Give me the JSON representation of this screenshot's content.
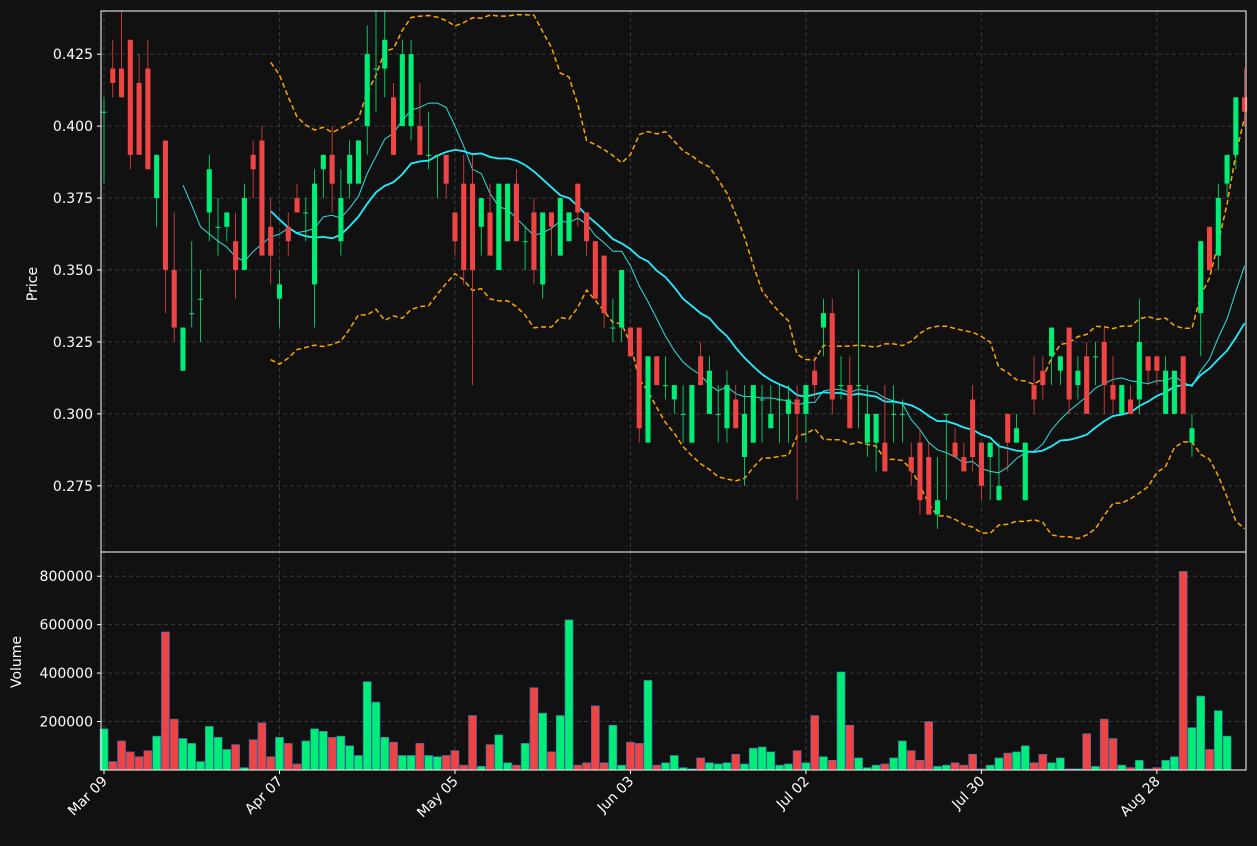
{
  "chart_data": {
    "type": "candlestick",
    "xticks": [
      "Mar 09",
      "Apr 07",
      "May 05",
      "Jun 03",
      "Jul 02",
      "Jul 30",
      "Aug 28"
    ],
    "xtick_index": [
      0,
      20,
      40,
      60,
      80,
      100,
      120
    ],
    "price_panel": {
      "ylabel": "Price",
      "ylim": [
        0.252,
        0.44
      ],
      "yticks": [
        "0.425",
        "0.400",
        "0.375",
        "0.350",
        "0.325",
        "0.300",
        "0.275"
      ],
      "ytick_values": [
        0.425,
        0.4,
        0.375,
        0.35,
        0.325,
        0.3,
        0.275
      ],
      "grid": true
    },
    "volume_panel": {
      "ylabel": "Volume",
      "ylim": [
        0,
        900000
      ],
      "yticks": [
        "200000",
        "400000",
        "600000",
        "800000"
      ],
      "ytick_values": [
        200000,
        400000,
        600000,
        800000
      ],
      "grid": true
    },
    "colors": {
      "background": "#111111",
      "up": "#00ee77",
      "down": "#ee4444",
      "ma_short": "#33dddd",
      "ma_long": "#22eeff",
      "bands": "#ffa500",
      "grid": "#3a3a3a",
      "axis": "#ffffff"
    },
    "ohlc": [
      [
        0.405,
        0.41,
        0.38,
        0.405
      ],
      [
        0.42,
        0.43,
        0.41,
        0.415
      ],
      [
        0.42,
        0.44,
        0.41,
        0.41
      ],
      [
        0.43,
        0.43,
        0.385,
        0.39
      ],
      [
        0.415,
        0.425,
        0.39,
        0.39
      ],
      [
        0.42,
        0.43,
        0.385,
        0.385
      ],
      [
        0.375,
        0.39,
        0.365,
        0.39
      ],
      [
        0.395,
        0.395,
        0.335,
        0.35
      ],
      [
        0.35,
        0.37,
        0.325,
        0.33
      ],
      [
        0.315,
        0.33,
        0.315,
        0.33
      ],
      [
        0.335,
        0.36,
        0.33,
        0.335
      ],
      [
        0.34,
        0.35,
        0.325,
        0.34
      ],
      [
        0.37,
        0.39,
        0.36,
        0.385
      ],
      [
        0.365,
        0.375,
        0.355,
        0.365
      ],
      [
        0.365,
        0.37,
        0.36,
        0.37
      ],
      [
        0.36,
        0.37,
        0.34,
        0.35
      ],
      [
        0.35,
        0.38,
        0.35,
        0.375
      ],
      [
        0.39,
        0.395,
        0.375,
        0.385
      ],
      [
        0.395,
        0.4,
        0.355,
        0.355
      ],
      [
        0.365,
        0.375,
        0.345,
        0.355
      ],
      [
        0.34,
        0.35,
        0.33,
        0.345
      ],
      [
        0.365,
        0.37,
        0.355,
        0.36
      ],
      [
        0.375,
        0.38,
        0.37,
        0.37
      ],
      [
        0.37,
        0.375,
        0.36,
        0.37
      ],
      [
        0.345,
        0.385,
        0.33,
        0.38
      ],
      [
        0.385,
        0.39,
        0.375,
        0.39
      ],
      [
        0.39,
        0.4,
        0.37,
        0.38
      ],
      [
        0.36,
        0.385,
        0.355,
        0.375
      ],
      [
        0.38,
        0.395,
        0.375,
        0.39
      ],
      [
        0.38,
        0.395,
        0.38,
        0.395
      ],
      [
        0.4,
        0.435,
        0.39,
        0.425
      ],
      [
        0.42,
        0.44,
        0.405,
        0.42
      ],
      [
        0.42,
        0.44,
        0.41,
        0.43
      ],
      [
        0.41,
        0.415,
        0.39,
        0.39
      ],
      [
        0.4,
        0.43,
        0.4,
        0.425
      ],
      [
        0.4,
        0.43,
        0.395,
        0.425
      ],
      [
        0.4,
        0.415,
        0.39,
        0.39
      ],
      [
        0.39,
        0.405,
        0.385,
        0.39
      ],
      [
        0.39,
        0.39,
        0.375,
        0.39
      ],
      [
        0.39,
        0.39,
        0.375,
        0.38
      ],
      [
        0.37,
        0.37,
        0.355,
        0.36
      ],
      [
        0.38,
        0.39,
        0.345,
        0.35
      ],
      [
        0.38,
        0.39,
        0.31,
        0.35
      ],
      [
        0.365,
        0.375,
        0.355,
        0.375
      ],
      [
        0.37,
        0.38,
        0.355,
        0.355
      ],
      [
        0.35,
        0.38,
        0.35,
        0.38
      ],
      [
        0.36,
        0.38,
        0.36,
        0.38
      ],
      [
        0.38,
        0.385,
        0.36,
        0.36
      ],
      [
        0.36,
        0.365,
        0.35,
        0.36
      ],
      [
        0.37,
        0.375,
        0.345,
        0.35
      ],
      [
        0.345,
        0.37,
        0.34,
        0.37
      ],
      [
        0.37,
        0.37,
        0.355,
        0.365
      ],
      [
        0.355,
        0.375,
        0.355,
        0.375
      ],
      [
        0.36,
        0.37,
        0.36,
        0.37
      ],
      [
        0.38,
        0.38,
        0.365,
        0.37
      ],
      [
        0.37,
        0.37,
        0.355,
        0.36
      ],
      [
        0.36,
        0.36,
        0.34,
        0.34
      ],
      [
        0.355,
        0.355,
        0.33,
        0.335
      ],
      [
        0.33,
        0.34,
        0.325,
        0.33
      ],
      [
        0.33,
        0.35,
        0.325,
        0.35
      ],
      [
        0.33,
        0.33,
        0.32,
        0.32
      ],
      [
        0.33,
        0.33,
        0.29,
        0.295
      ],
      [
        0.29,
        0.32,
        0.29,
        0.32
      ],
      [
        0.32,
        0.32,
        0.31,
        0.31
      ],
      [
        0.31,
        0.32,
        0.305,
        0.31
      ],
      [
        0.305,
        0.31,
        0.3,
        0.31
      ],
      [
        0.3,
        0.31,
        0.29,
        0.3
      ],
      [
        0.29,
        0.31,
        0.29,
        0.31
      ],
      [
        0.32,
        0.325,
        0.31,
        0.31
      ],
      [
        0.3,
        0.32,
        0.3,
        0.315
      ],
      [
        0.3,
        0.31,
        0.29,
        0.3
      ],
      [
        0.295,
        0.315,
        0.29,
        0.31
      ],
      [
        0.305,
        0.31,
        0.295,
        0.295
      ],
      [
        0.285,
        0.31,
        0.275,
        0.3
      ],
      [
        0.29,
        0.31,
        0.29,
        0.31
      ],
      [
        0.305,
        0.31,
        0.29,
        0.305
      ],
      [
        0.295,
        0.31,
        0.295,
        0.3
      ],
      [
        0.305,
        0.31,
        0.29,
        0.305
      ],
      [
        0.3,
        0.31,
        0.29,
        0.305
      ],
      [
        0.305,
        0.31,
        0.27,
        0.3
      ],
      [
        0.3,
        0.31,
        0.29,
        0.31
      ],
      [
        0.315,
        0.32,
        0.305,
        0.31
      ],
      [
        0.33,
        0.34,
        0.32,
        0.335
      ],
      [
        0.335,
        0.34,
        0.3,
        0.305
      ],
      [
        0.31,
        0.32,
        0.305,
        0.31
      ],
      [
        0.31,
        0.32,
        0.3,
        0.295
      ],
      [
        0.31,
        0.35,
        0.295,
        0.31
      ],
      [
        0.29,
        0.31,
        0.285,
        0.3
      ],
      [
        0.29,
        0.3,
        0.28,
        0.3
      ],
      [
        0.29,
        0.31,
        0.28,
        0.28
      ],
      [
        0.3,
        0.31,
        0.29,
        0.3
      ],
      [
        0.3,
        0.305,
        0.29,
        0.3
      ],
      [
        0.285,
        0.29,
        0.275,
        0.28
      ],
      [
        0.29,
        0.295,
        0.265,
        0.27
      ],
      [
        0.285,
        0.29,
        0.265,
        0.265
      ],
      [
        0.265,
        0.285,
        0.26,
        0.27
      ],
      [
        0.3,
        0.3,
        0.27,
        0.3
      ],
      [
        0.29,
        0.295,
        0.285,
        0.285
      ],
      [
        0.285,
        0.29,
        0.28,
        0.28
      ],
      [
        0.305,
        0.31,
        0.28,
        0.285
      ],
      [
        0.29,
        0.29,
        0.27,
        0.275
      ],
      [
        0.285,
        0.29,
        0.27,
        0.29
      ],
      [
        0.27,
        0.29,
        0.27,
        0.275
      ],
      [
        0.3,
        0.3,
        0.28,
        0.29
      ],
      [
        0.29,
        0.3,
        0.29,
        0.295
      ],
      [
        0.27,
        0.29,
        0.27,
        0.29
      ],
      [
        0.31,
        0.32,
        0.3,
        0.305
      ],
      [
        0.315,
        0.32,
        0.305,
        0.31
      ],
      [
        0.32,
        0.33,
        0.31,
        0.33
      ],
      [
        0.315,
        0.32,
        0.31,
        0.32
      ],
      [
        0.33,
        0.33,
        0.3,
        0.305
      ],
      [
        0.31,
        0.32,
        0.305,
        0.315
      ],
      [
        0.32,
        0.325,
        0.3,
        0.3
      ],
      [
        0.32,
        0.325,
        0.31,
        0.32
      ],
      [
        0.325,
        0.33,
        0.3,
        0.31
      ],
      [
        0.31,
        0.32,
        0.3,
        0.305
      ],
      [
        0.3,
        0.31,
        0.3,
        0.31
      ],
      [
        0.305,
        0.31,
        0.3,
        0.3
      ],
      [
        0.305,
        0.34,
        0.3,
        0.325
      ],
      [
        0.32,
        0.32,
        0.31,
        0.315
      ],
      [
        0.32,
        0.32,
        0.31,
        0.315
      ],
      [
        0.3,
        0.32,
        0.3,
        0.315
      ],
      [
        0.3,
        0.31,
        0.3,
        0.315
      ],
      [
        0.32,
        0.32,
        0.3,
        0.3
      ],
      [
        0.29,
        0.3,
        0.285,
        0.295
      ],
      [
        0.335,
        0.36,
        0.32,
        0.36
      ],
      [
        0.365,
        0.365,
        0.35,
        0.35
      ],
      [
        0.355,
        0.38,
        0.35,
        0.375
      ],
      [
        0.38,
        0.385,
        0.375,
        0.39
      ],
      [
        0.39,
        0.41,
        0.385,
        0.41
      ],
      [
        0.41,
        0.42,
        0.4,
        0.405
      ]
    ],
    "volume": [
      170000,
      35000,
      120000,
      75000,
      55000,
      80000,
      140000,
      570000,
      210000,
      130000,
      110000,
      35000,
      180000,
      135000,
      85000,
      105000,
      10000,
      125000,
      195000,
      55000,
      135000,
      110000,
      25000,
      120000,
      170000,
      160000,
      135000,
      140000,
      100000,
      60000,
      365000,
      280000,
      135000,
      115000,
      60000,
      60000,
      110000,
      60000,
      55000,
      60000,
      80000,
      20000,
      225000,
      15000,
      105000,
      145000,
      30000,
      20000,
      110000,
      340000,
      235000,
      75000,
      225000,
      620000,
      20000,
      30000,
      265000,
      30000,
      185000,
      20000,
      115000,
      110000,
      370000,
      20000,
      30000,
      60000,
      10000,
      5000,
      50000,
      30000,
      25000,
      30000,
      65000,
      25000,
      90000,
      95000,
      75000,
      20000,
      25000,
      80000,
      30000,
      225000,
      55000,
      40000,
      405000,
      185000,
      50000,
      10000,
      20000,
      25000,
      50000,
      120000,
      80000,
      40000,
      200000,
      15000,
      20000,
      30000,
      20000,
      65000,
      5000,
      20000,
      50000,
      70000,
      75000,
      100000,
      30000,
      65000,
      30000,
      50000,
      5000,
      5000,
      150000,
      15000,
      210000,
      130000,
      20000,
      10000,
      40000,
      5000,
      10000,
      40000,
      55000,
      820000,
      175000,
      305000,
      85000,
      245000,
      140000
    ]
  }
}
